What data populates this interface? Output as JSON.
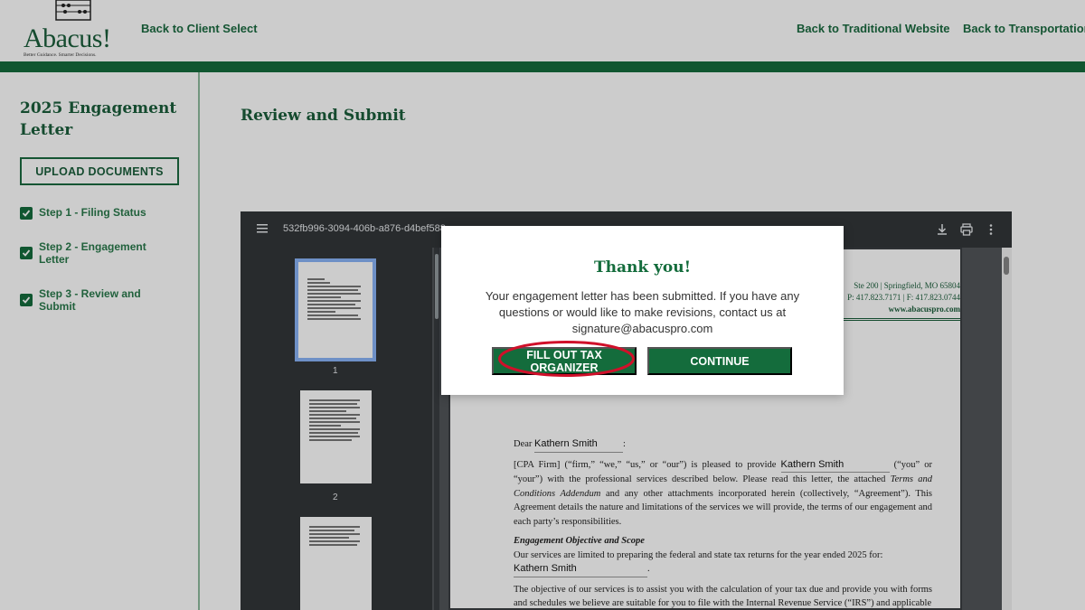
{
  "header": {
    "logo_text": "Abacus!",
    "logo_tagline": "Better Guidance. Smarter Decisions.",
    "back_to_client_select": "Back to Client Select",
    "back_to_traditional": "Back to Traditional Website",
    "back_to_transportation": "Back to Transportation"
  },
  "sidebar": {
    "title": "2025 Engagement Letter",
    "upload_label": "UPLOAD DOCUMENTS",
    "steps": [
      {
        "label": "Step 1 - Filing Status"
      },
      {
        "label": "Step 2 - Engagement Letter"
      },
      {
        "label": "Step 3 - Review and Submit"
      }
    ]
  },
  "main": {
    "title": "Review and Submit"
  },
  "pdf_viewer": {
    "doc_id": "532fb996-3094-406b-a876-d4bef588",
    "thumb_numbers": [
      "1",
      "2"
    ],
    "firm_address_line1": "Ste 200 | Springfield, MO 65804",
    "firm_address_line2": "P: 417.823.7171 | F: 417.823.0744",
    "firm_website": "www.abacuspro.com",
    "letter": {
      "dear": "Dear",
      "recipient": "Kathern Smith",
      "para1_a": "[CPA Firm] (“firm,” “we,” “us,” or “our”) is pleased to provide",
      "client_name": "Kathern Smith",
      "para1_b": "(“you” or “your”) with the professional services described below. Please read this letter, the attached",
      "terms": "Terms and Conditions Addendum",
      "para1_c": "and any other attachments incorporated herein (collectively, “Agreement”). This Agreement details the nature and limitations of the services we will provide, the terms of our engagement and each party’s responsibilities.",
      "section_heading": "Engagement Objective and Scope",
      "para2": "Our services are limited to preparing the federal and state tax returns for the year ended 2025 for:",
      "scope_name": "Kathern Smith",
      "para3": "The objective of our services is to assist you with the calculation of your tax due and provide you with forms and schedules we believe are suitable for you to file with the Internal Revenue Service (“IRS”) and applicable"
    }
  },
  "modal": {
    "title": "Thank you!",
    "message": "Your engagement letter has been submitted. If you have any questions or would like to make revisions, contact us at signature@abacuspro.com",
    "fill_out_button": "FILL OUT TAX ORGANIZER",
    "continue_button": "CONTINUE"
  },
  "colors": {
    "brand_green": "#146c3c",
    "annotation_red": "#d0102a"
  }
}
